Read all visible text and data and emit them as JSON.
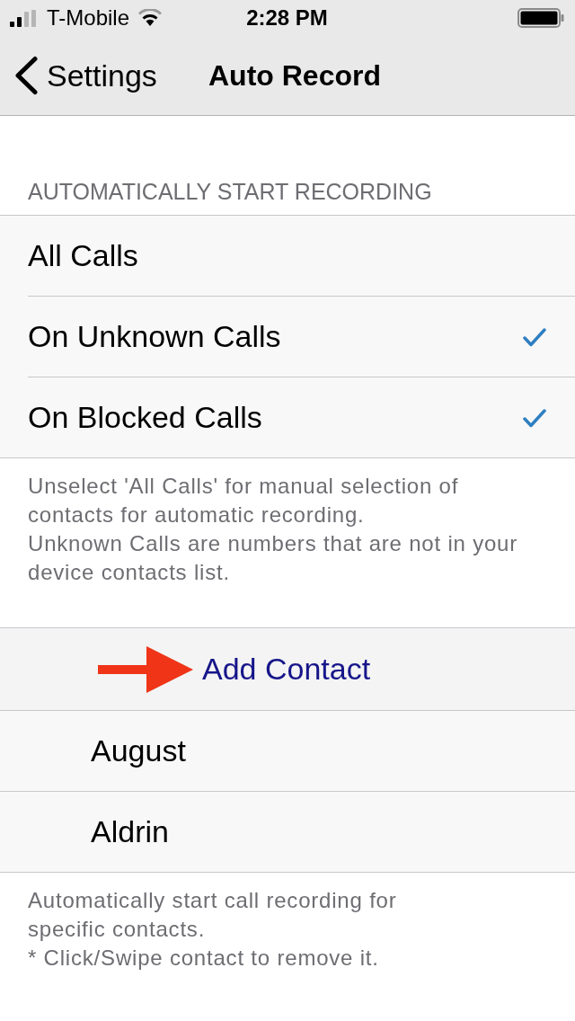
{
  "status_bar": {
    "carrier": "T-Mobile",
    "time": "2:28 PM"
  },
  "nav_bar": {
    "back": "Settings",
    "title": "Auto Record"
  },
  "recording_section": {
    "header": "AUTOMATICALLY START RECORDING",
    "options": [
      {
        "label": "All Calls",
        "checked": false
      },
      {
        "label": "On Unknown Calls",
        "checked": true
      },
      {
        "label": "On Blocked Calls",
        "checked": true
      }
    ],
    "footer": "Unselect 'All Calls' for manual selection of contacts for automatic recording.\nUnknown Calls are numbers that are not in your device contacts list."
  },
  "contacts_section": {
    "add_button": "Add Contact",
    "contacts": [
      {
        "name": "August"
      },
      {
        "name": "Aldrin"
      }
    ],
    "footer": "Automatically start call recording for\nspecific contacts.\n* Click/Swipe contact to remove it."
  }
}
